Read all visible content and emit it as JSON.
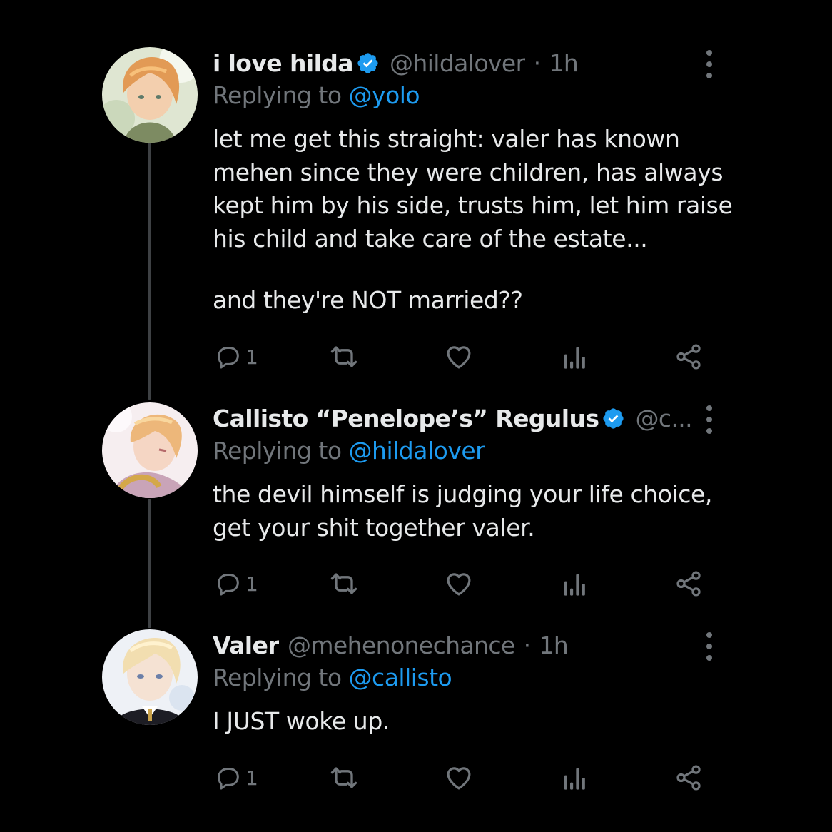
{
  "tweets": [
    {
      "name": "i love hilda",
      "handle": "@hildalover",
      "dot": "·",
      "time": "1h",
      "replying_prefix": "Replying to ",
      "replying_to": "@yolo",
      "body_lines": [
        "let me get this straight: valer has known",
        "mehen since they were children, has always",
        "kept him by his side, trusts him, let him raise",
        "his child and take care of the estate..."
      ],
      "body_extra": "and they're NOT married??",
      "reply_count": "1",
      "verified": true
    },
    {
      "name": "Callisto “Penelope’s” Regulus",
      "handle": "@c...",
      "replying_prefix": "Replying to ",
      "replying_to": "@hildalover",
      "body_lines": [
        "the devil himself is judging your life choice,",
        "get your shit together valer."
      ],
      "reply_count": "1",
      "verified": true
    },
    {
      "name": "Valer",
      "handle": "@mehenonechance",
      "dot": "·",
      "time": "1h",
      "replying_prefix": "Replying to ",
      "replying_to": "@callisto",
      "body_lines": [
        "I JUST woke up."
      ],
      "reply_count": "1",
      "verified": false
    }
  ],
  "icons": {
    "reply": "reply-icon",
    "retweet": "retweet-icon",
    "like": "heart-icon",
    "views": "analytics-icon",
    "share": "share-icon",
    "more": "more-vertical-icon",
    "verified": "verified-badge-icon"
  },
  "colors": {
    "background": "#000000",
    "text": "#e7e9ea",
    "secondary": "#71767b",
    "link": "#1d9bf0",
    "thread_line": "#3e4144"
  }
}
